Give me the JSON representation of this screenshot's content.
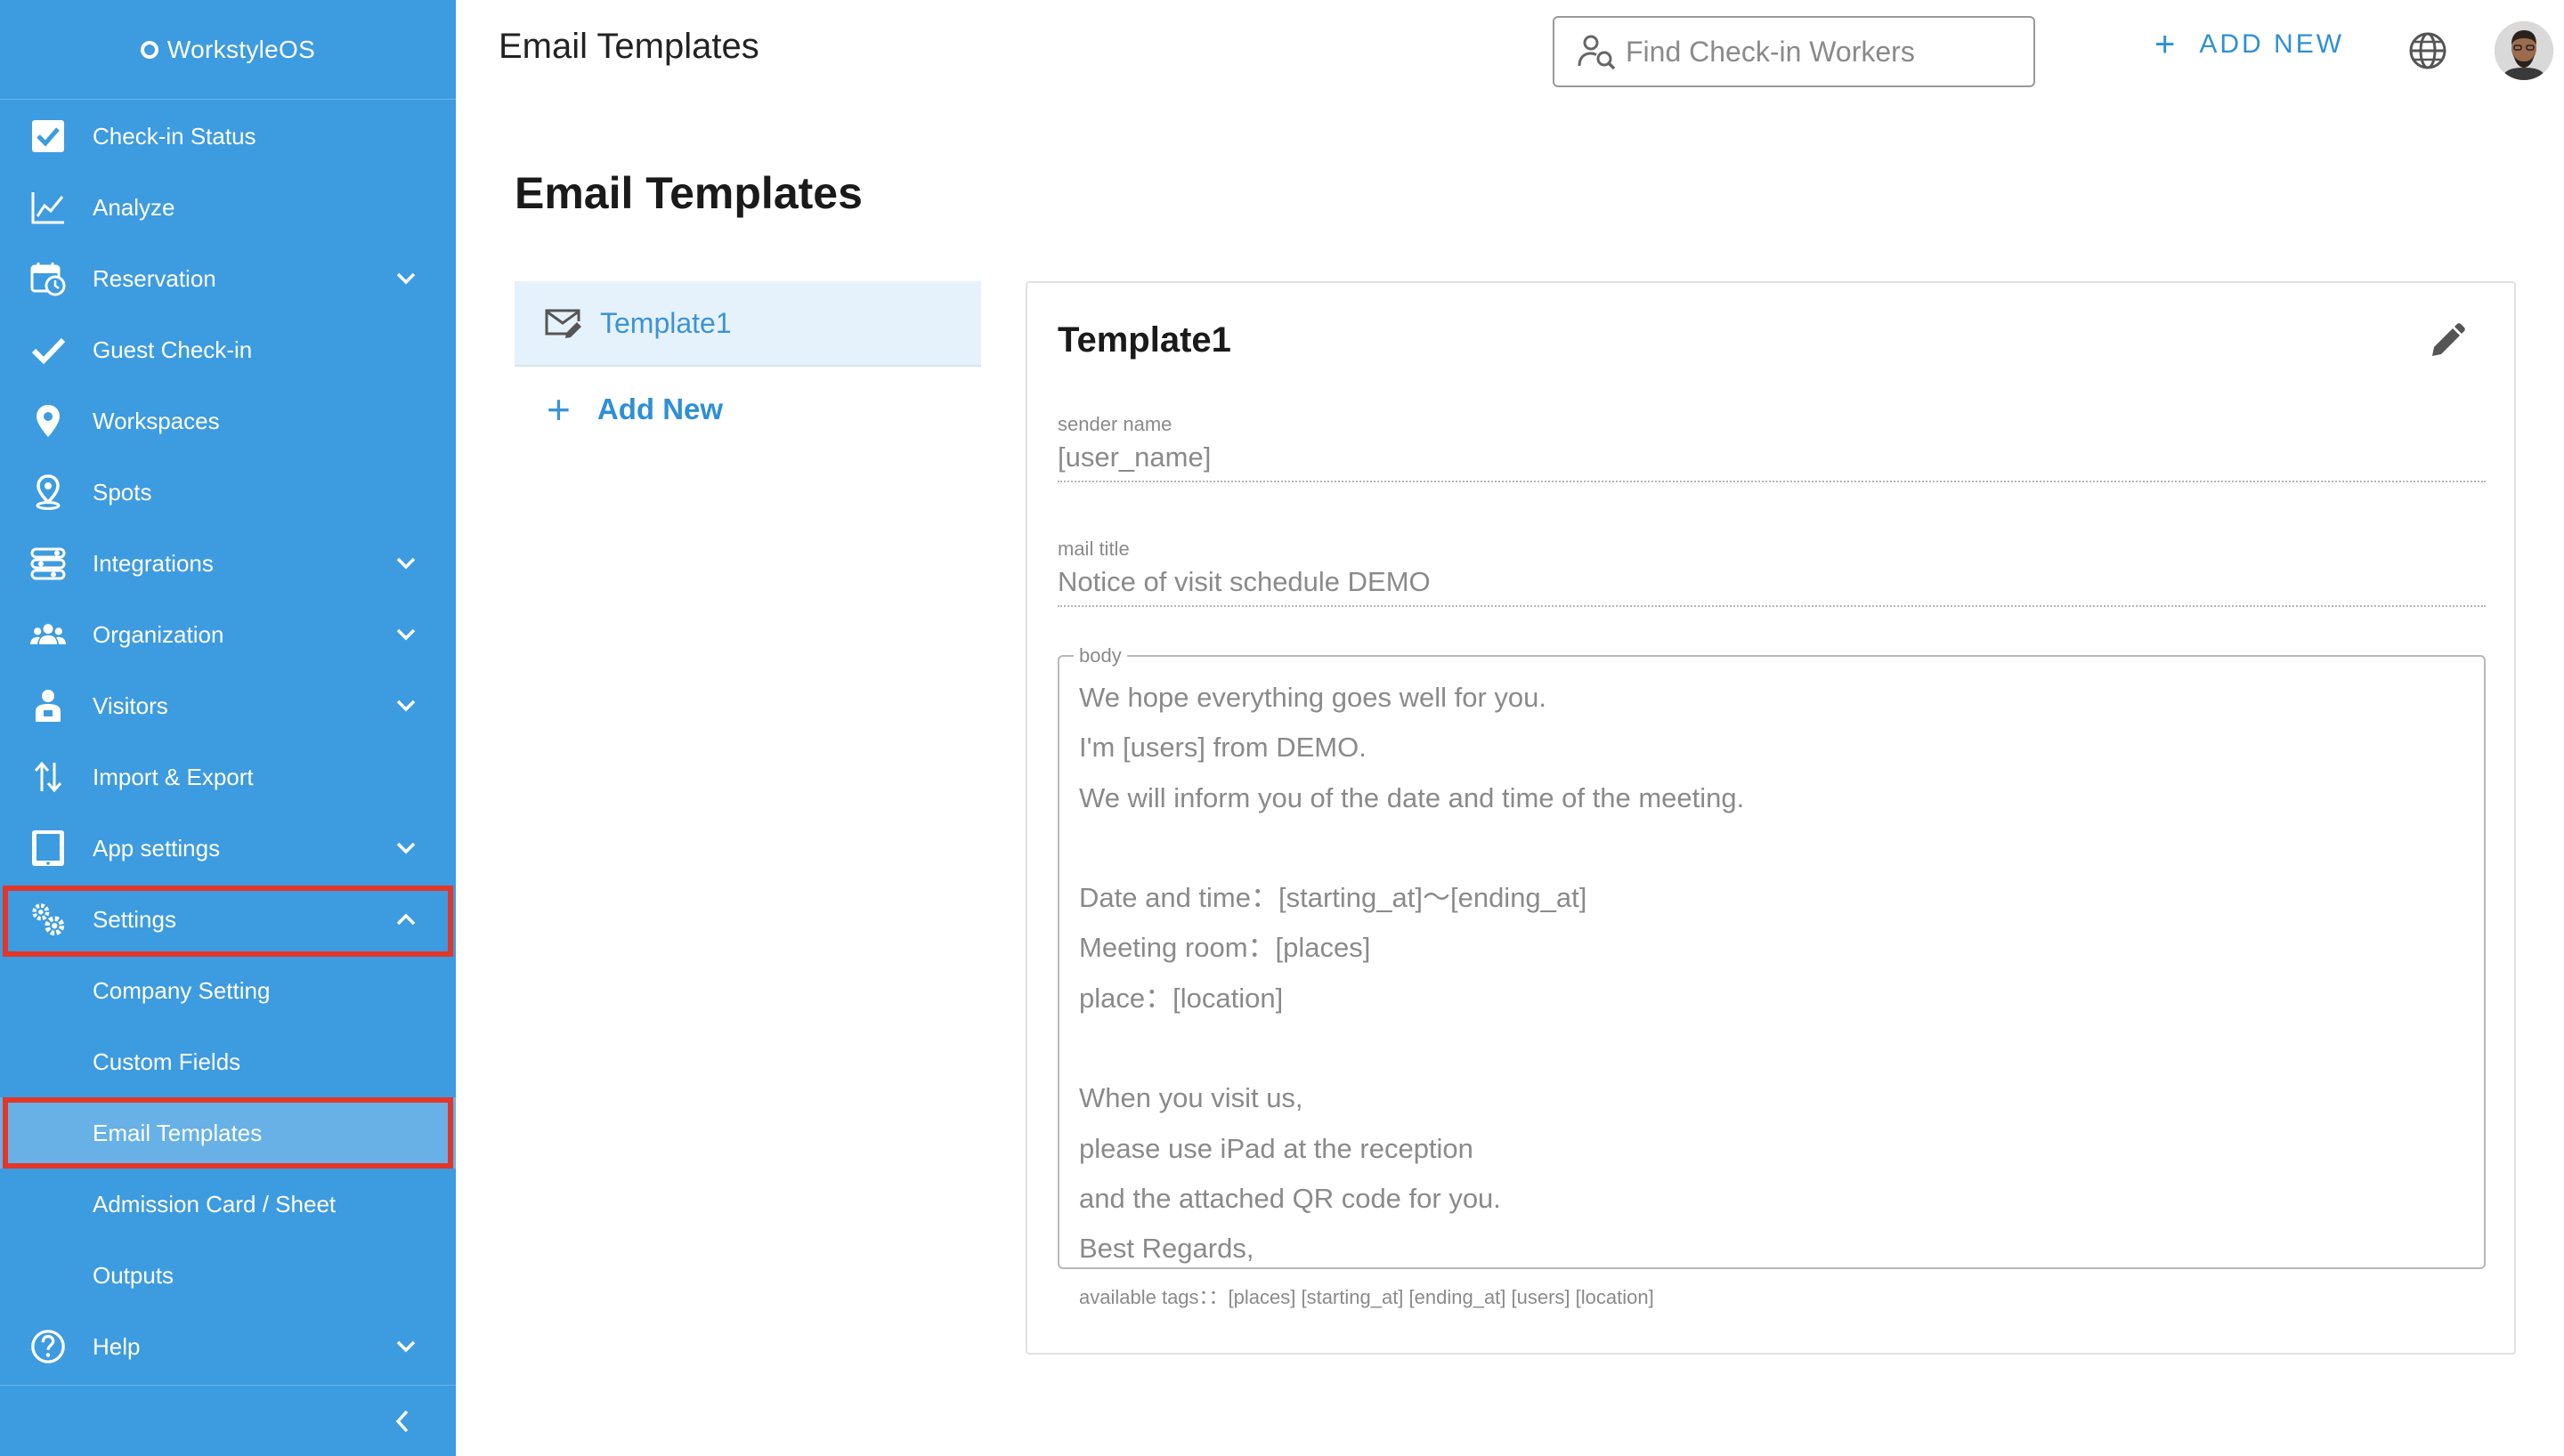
{
  "brand": {
    "name": "WorkstyleOS"
  },
  "sidebar": {
    "items": [
      {
        "label": "Check-in Status",
        "icon": "checkbox-icon",
        "has_chevron": false
      },
      {
        "label": "Analyze",
        "icon": "chart-line-icon",
        "has_chevron": false
      },
      {
        "label": "Reservation",
        "icon": "calendar-clock-icon",
        "has_chevron": true
      },
      {
        "label": "Guest Check-in",
        "icon": "check-icon",
        "has_chevron": false
      },
      {
        "label": "Workspaces",
        "icon": "map-pin-icon",
        "has_chevron": false
      },
      {
        "label": "Spots",
        "icon": "spot-pin-icon",
        "has_chevron": false
      },
      {
        "label": "Integrations",
        "icon": "integrations-icon",
        "has_chevron": true
      },
      {
        "label": "Organization",
        "icon": "group-icon",
        "has_chevron": true
      },
      {
        "label": "Visitors",
        "icon": "visitor-icon",
        "has_chevron": true
      },
      {
        "label": "Import & Export",
        "icon": "import-export-icon",
        "has_chevron": false
      },
      {
        "label": "App settings",
        "icon": "tablet-icon",
        "has_chevron": true
      },
      {
        "label": "Settings",
        "icon": "gears-icon",
        "has_chevron": true,
        "expanded": true,
        "highlighted": true
      }
    ],
    "settings_subitems": [
      {
        "label": "Company Setting"
      },
      {
        "label": "Custom Fields"
      },
      {
        "label": "Email Templates",
        "selected": true,
        "highlighted": true
      },
      {
        "label": "Admission Card / Sheet"
      },
      {
        "label": "Outputs"
      }
    ],
    "help": {
      "label": "Help",
      "icon": "help-icon",
      "has_chevron": true
    },
    "collapse_icon": "chevron-left-icon"
  },
  "topbar": {
    "title": "Email Templates",
    "search_placeholder": "Find Check-in Workers",
    "add_new_label": "ADD NEW",
    "globe_icon": "globe-icon"
  },
  "main": {
    "heading": "Email Templates",
    "templates": [
      {
        "label": "Template1",
        "selected": true
      }
    ],
    "add_new_label": "Add New"
  },
  "template_detail": {
    "title": "Template1",
    "sender_name_label": "sender name",
    "sender_name_value": "[user_name]",
    "mail_title_label": "mail title",
    "mail_title_value": "Notice of visit schedule DEMO",
    "body_label": "body",
    "body_text": "We hope everything goes well for you.\nI'm [users] from DEMO.\nWe will inform you of the date and time of the meeting.\n\nDate and time：[starting_at]〜[ending_at]\nMeeting room：[places]\nplace：[location]\n\nWhen you visit us,\nplease use iPad at the reception\nand the attached QR code for you.\nBest Regards,",
    "available_tags": "available tags：：[places] [starting_at] [ending_at] [users] [location]"
  },
  "colors": {
    "sidebar_bg": "#3d9be0",
    "accent": "#2f8fd6",
    "highlight_border": "#e2362a",
    "selected_item_bg": "#e6f2fb"
  }
}
